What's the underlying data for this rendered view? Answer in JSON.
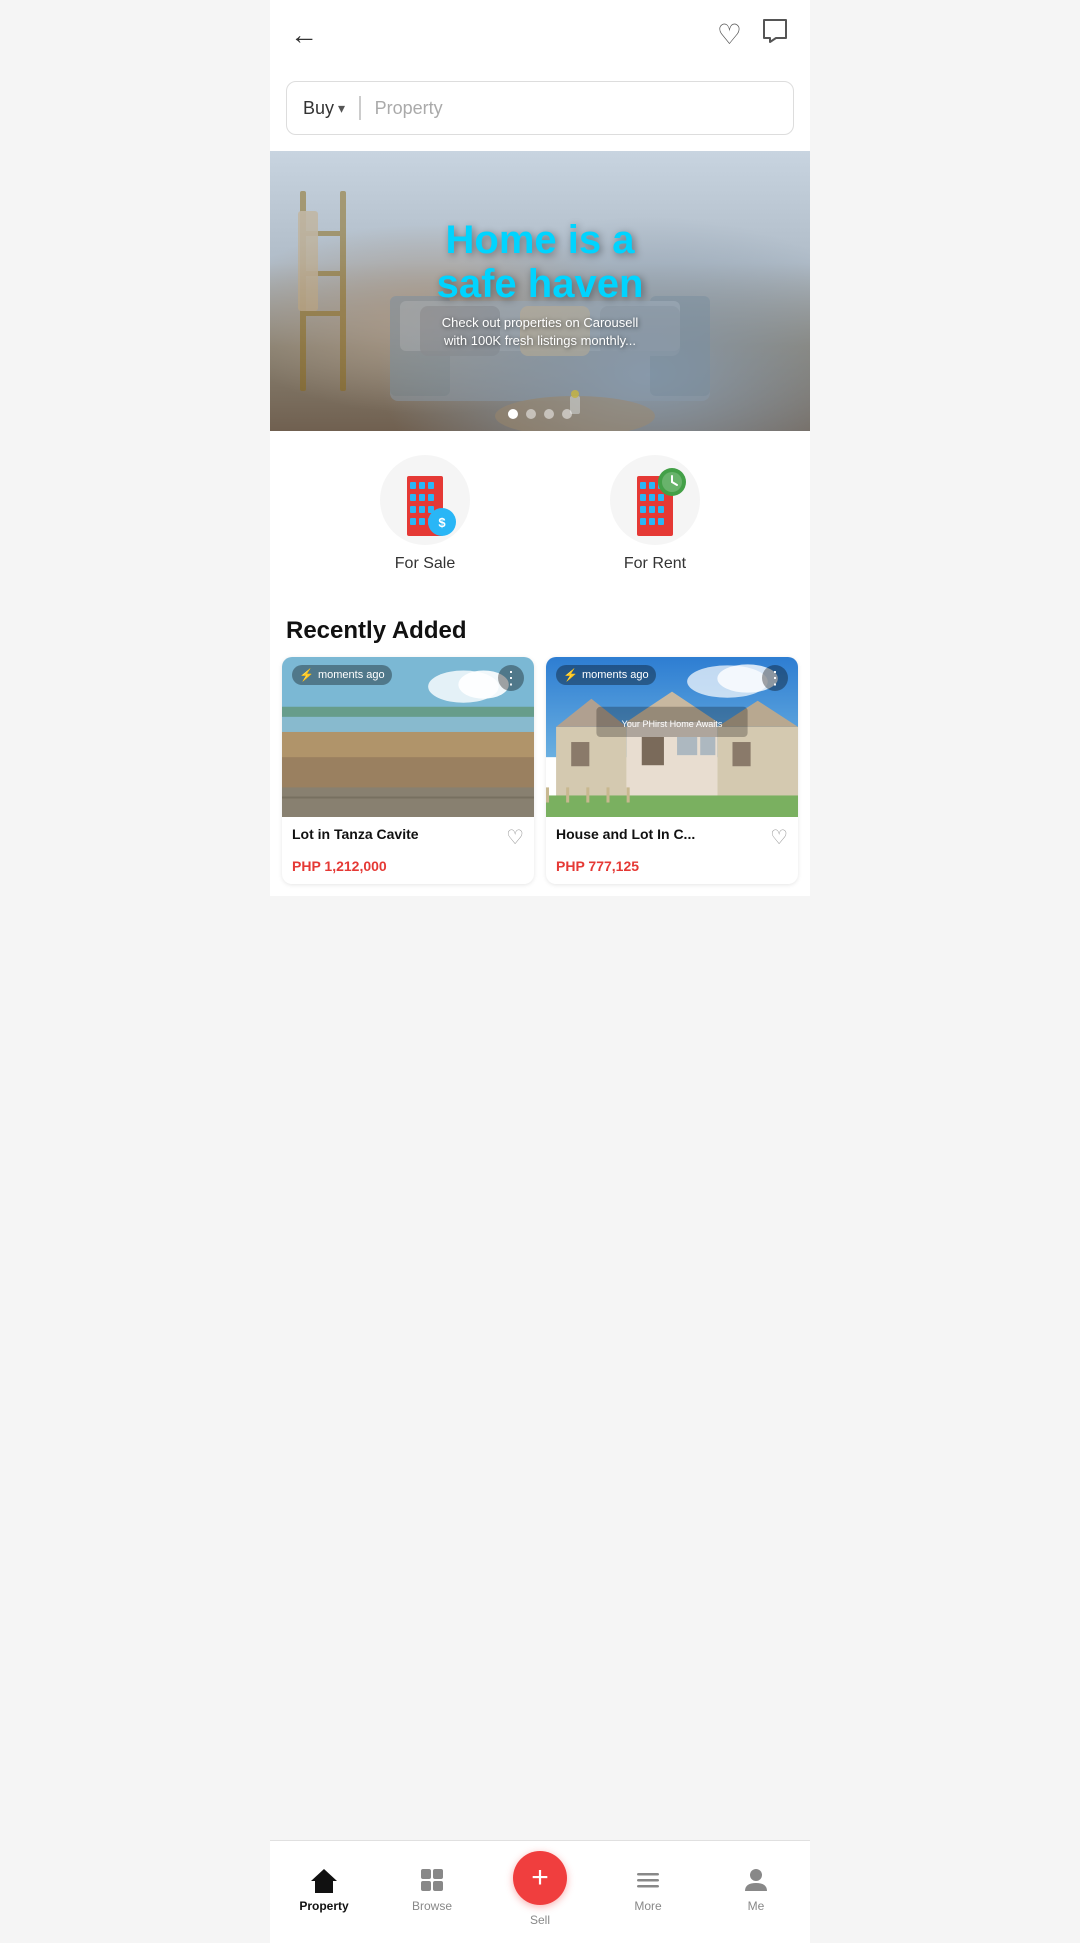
{
  "header": {
    "back_label": "←",
    "heart_icon": "♡",
    "chat_icon": "💬"
  },
  "search": {
    "dropdown_label": "Buy",
    "placeholder": "Property"
  },
  "banner": {
    "title": "Home is a\nsafe haven",
    "subtitle": "Check out properties on Carousell\nwith 100K fresh listings monthly...",
    "dots": [
      true,
      false,
      false,
      false
    ]
  },
  "categories": [
    {
      "id": "for-sale",
      "label": "For Sale",
      "type": "sale"
    },
    {
      "id": "for-rent",
      "label": "For Rent",
      "type": "rent"
    }
  ],
  "recently_added": {
    "title": "Recently Added",
    "listings": [
      {
        "id": "lot-tanza",
        "time": "moments ago",
        "title": "Lot in Tanza Cavite",
        "price": "PHP 1,212,000",
        "type": "lot"
      },
      {
        "id": "house-lot",
        "time": "moments ago",
        "title": "House and Lot In C...",
        "price": "PHP 777,125",
        "type": "house"
      }
    ]
  },
  "bottom_nav": {
    "items": [
      {
        "id": "property",
        "label": "Property",
        "icon": "🏠",
        "active": true
      },
      {
        "id": "browse",
        "label": "Browse",
        "icon": "⊞",
        "active": false
      },
      {
        "id": "sell",
        "label": "Sell",
        "icon": "+",
        "active": false
      },
      {
        "id": "more",
        "label": "More",
        "icon": "☰",
        "active": false
      },
      {
        "id": "me",
        "label": "Me",
        "icon": "👤",
        "active": false
      }
    ]
  }
}
